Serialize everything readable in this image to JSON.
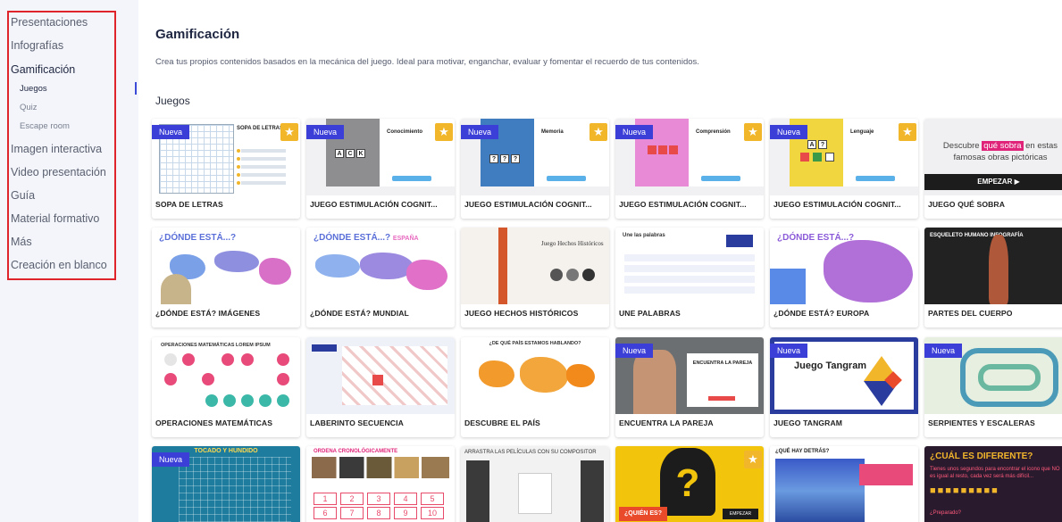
{
  "sidebar": {
    "items": [
      {
        "label": "Presentaciones"
      },
      {
        "label": "Infografías"
      },
      {
        "label": "Gamificación"
      },
      {
        "label": "Imagen interactiva"
      },
      {
        "label": "Video presentación"
      },
      {
        "label": "Guía"
      },
      {
        "label": "Material formativo"
      },
      {
        "label": "Más"
      },
      {
        "label": "Creación en blanco"
      }
    ],
    "subitems": [
      {
        "label": "Juegos"
      },
      {
        "label": "Quiz"
      },
      {
        "label": "Escape room"
      }
    ],
    "active": "Gamificación",
    "active_sub": "Juegos"
  },
  "main": {
    "title": "Gamificación",
    "description": "Crea tus propios contenidos basados en la mecánica del juego. Ideal para motivar, enganchar, evaluar y fomentar el recuerdo de tus contenidos.",
    "section": "Juegos",
    "badge_new": "Nueva",
    "cards": [
      {
        "label": "SOPA DE LETRAS",
        "new": true,
        "star": true
      },
      {
        "label": "JUEGO ESTIMULACIÓN COGNIT...",
        "new": true,
        "star": true,
        "thumb_title": "Conocimiento",
        "thumb_letters": "ACK"
      },
      {
        "label": "JUEGO ESTIMULACIÓN COGNIT...",
        "new": true,
        "star": true,
        "thumb_title": "Memoria",
        "thumb_letters": "???"
      },
      {
        "label": "JUEGO ESTIMULACIÓN COGNIT...",
        "new": true,
        "star": true,
        "thumb_title": "Comprensión"
      },
      {
        "label": "JUEGO ESTIMULACIÓN COGNIT...",
        "new": true,
        "star": true,
        "thumb_title": "Lenguaje"
      },
      {
        "label": "JUEGO QUÉ SOBRA",
        "new": false,
        "star": false,
        "thumb_text_before": "Descubre",
        "thumb_text_highlight": "qué sobra",
        "thumb_text_after": "en estas famosas obras pictóricas",
        "thumb_button": "EMPEZAR ▶"
      },
      {
        "label": "¿DÓNDE ESTÁ? IMÁGENES",
        "thumb_title": "¿DÓNDE ESTÁ...?"
      },
      {
        "label": "¿DÓNDE ESTÁ? MUNDIAL",
        "thumb_title": "¿DÓNDE ESTÁ...?",
        "thumb_subtitle": "ESPAÑA"
      },
      {
        "label": "JUEGO HECHOS HISTÓRICOS",
        "thumb_title": "Juego Hechos Históricos"
      },
      {
        "label": "UNE PALABRAS",
        "thumb_title": "Une las palabras"
      },
      {
        "label": "¿DÓNDE ESTÁ? EUROPA",
        "thumb_title": "¿DÓNDE ESTÁ...?"
      },
      {
        "label": "PARTES DEL CUERPO",
        "thumb_title": "ESQUELETO HUMANO INFOGRAFÍA"
      },
      {
        "label": "OPERACIONES MATEMÁTICAS",
        "thumb_title": "OPERACIONES MATEMÁTICAS LOREM IPSUM"
      },
      {
        "label": "LABERINTO SECUENCIA"
      },
      {
        "label": "DESCUBRE EL PAÍS",
        "thumb_title": "¿DE QUÉ PAÍS ESTAMOS HABLANDO?"
      },
      {
        "label": "ENCUENTRA LA PAREJA",
        "new": true,
        "thumb_title": "ENCUENTRA LA PAREJA"
      },
      {
        "label": "JUEGO TANGRAM",
        "new": true,
        "thumb_title": "Juego Tangram"
      },
      {
        "label": "SERPIENTES Y ESCALERAS",
        "new": true
      },
      {
        "label": "",
        "new": true,
        "thumb_title": "TOCADO Y HUNDIDO"
      },
      {
        "label": "",
        "thumb_title": "ORDENA CRONOLÓGICAMENTE",
        "thumb_numbers": [
          "1",
          "2",
          "3",
          "4",
          "5",
          "6",
          "7",
          "8",
          "9",
          "10"
        ]
      },
      {
        "label": "",
        "thumb_title": "ARRASTRA LAS PELÍCULAS CON SU COMPOSITOR"
      },
      {
        "label": "",
        "star": true,
        "thumb_title": "¿QUIÉN ES?",
        "thumb_button": "EMPEZAR"
      },
      {
        "label": "",
        "thumb_title": "¿QUÉ HAY DETRÁS?"
      },
      {
        "label": "",
        "thumb_title": "¿CUÁL ES DIFERENTE?",
        "thumb_subtitle": "Tienes unos segundos para encontrar el icono que NO es igual al resto, cada vez será más difícil...",
        "thumb_footer": "¿Preparado?"
      }
    ]
  },
  "colors": {
    "accent": "#3b3fd8",
    "star": "#f2b62b",
    "highlight_box": "#e0242b",
    "sidebar_bg": "#f3f5fa"
  }
}
